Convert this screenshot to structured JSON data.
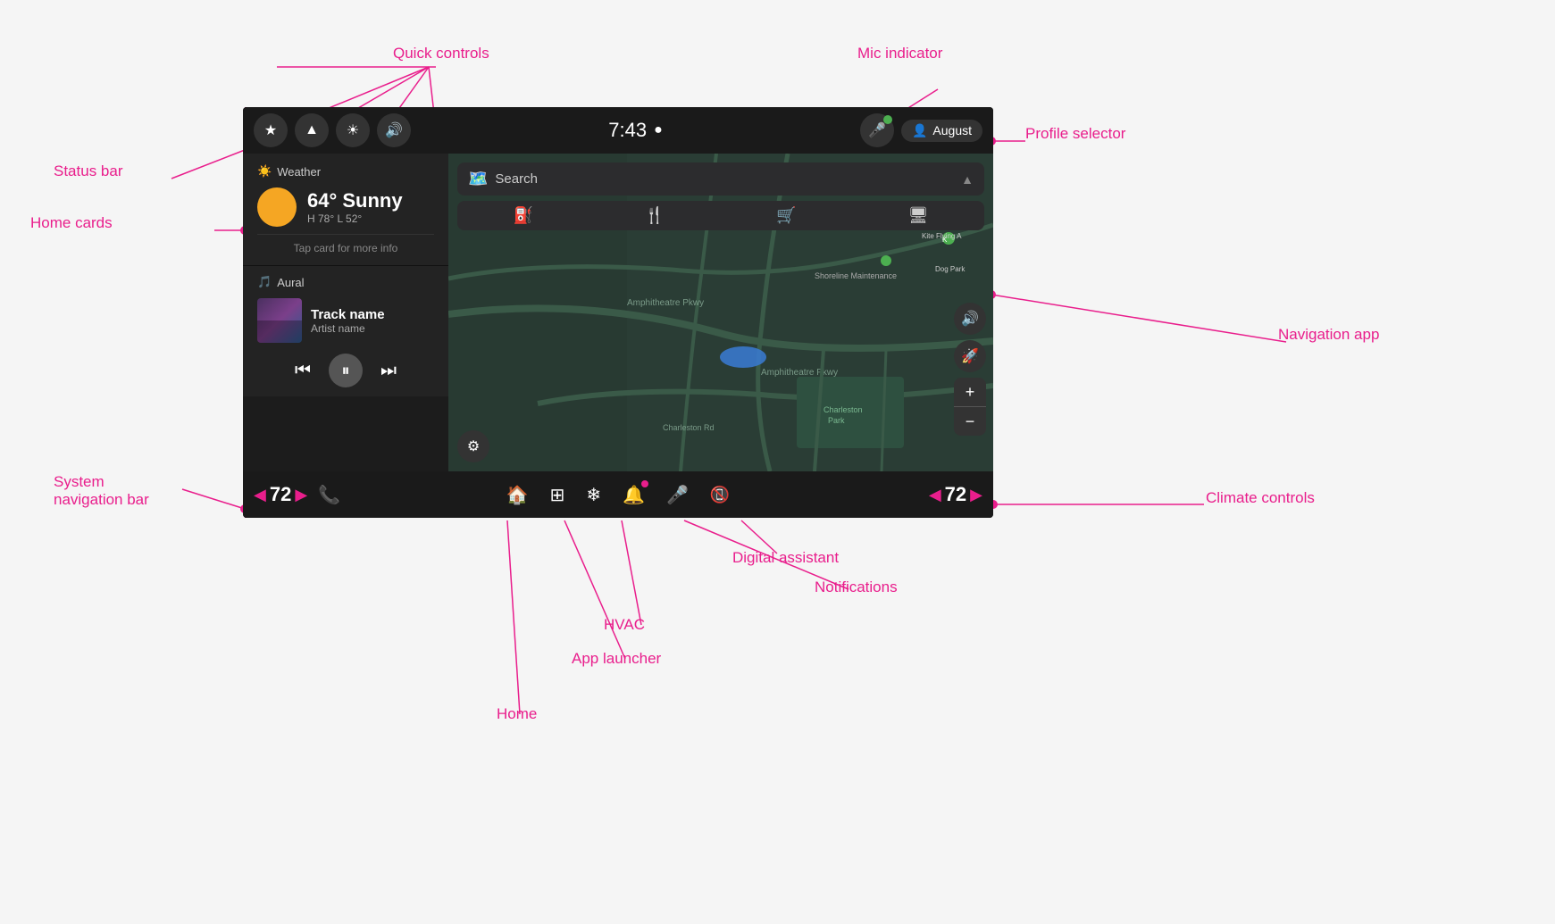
{
  "annotations": {
    "quick_controls": "Quick controls",
    "status_bar": "Status bar",
    "home_cards": "Home cards",
    "mic_indicator": "Mic indicator",
    "profile_selector": "Profile selector",
    "navigation_app": "Navigation app",
    "system_navigation_bar": "System\nnavigation bar",
    "climate_controls": "Climate controls",
    "digital_assistant": "Digital assistant",
    "notifications": "Notifications",
    "hvac": "HVAC",
    "app_launcher": "App launcher",
    "home": "Home"
  },
  "status_bar": {
    "time": "7:43",
    "profile_name": "August"
  },
  "weather": {
    "title": "Weather",
    "temperature": "64° Sunny",
    "high_low": "H 78° L 52°",
    "tap_info": "Tap card for more info"
  },
  "music": {
    "app_name": "Aural",
    "track_name": "Track name",
    "artist_name": "Artist name"
  },
  "search": {
    "placeholder": "Search"
  },
  "nav_bar": {
    "temp_left": "72",
    "temp_right": "72"
  }
}
